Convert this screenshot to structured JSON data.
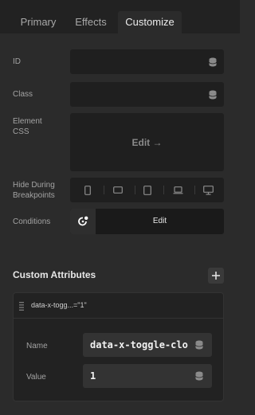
{
  "tabs": [
    {
      "label": "Primary",
      "active": false
    },
    {
      "label": "Effects",
      "active": false
    },
    {
      "label": "Customize",
      "active": true
    }
  ],
  "fields": {
    "id_label": "ID",
    "class_label": "Class",
    "element_css_label_1": "Element",
    "element_css_label_2": "CSS",
    "css_edit": "Edit →",
    "hide_label_1": "Hide During",
    "hide_label_2": "Breakpoints",
    "conditions_label": "Conditions",
    "conditions_edit": "Edit"
  },
  "breakpoints": [
    "phone-portrait",
    "phone-landscape",
    "tablet",
    "laptop",
    "desktop"
  ],
  "custom_attributes": {
    "title": "Custom Attributes",
    "item": {
      "summary": "data-x-togg...=\"1\"",
      "name_label": "Name",
      "name_value": "data-x-toggle-clo",
      "value_label": "Value",
      "value_value": "1"
    }
  },
  "colors": {
    "background": "#2b2b2b",
    "tabbar": "#222222",
    "field": "#1f1f1f",
    "accent_text": "#ececec"
  }
}
